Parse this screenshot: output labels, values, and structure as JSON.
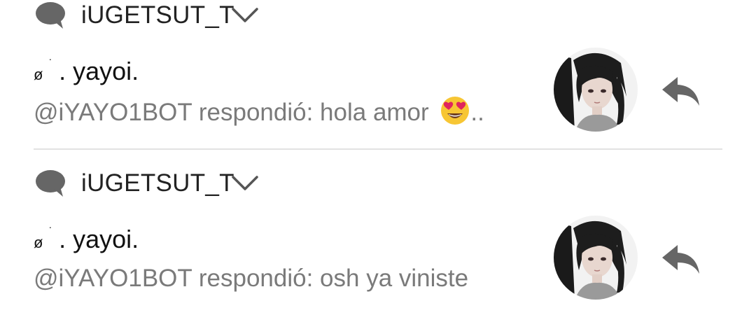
{
  "notifications": [
    {
      "app_name": "iUGETSUT_T",
      "sender_prefix": "ø",
      "sender_dot": "·",
      "sender_name": ". yayoi.",
      "message": "@iYAYO1BOT respondió: hola amor",
      "message_suffix": "..",
      "emoji": "heart-eyes-emoji",
      "avatar": "anime-girl-avatar",
      "action_icon": "reply-icon"
    },
    {
      "app_name": "iUGETSUT_T",
      "sender_prefix": "ø",
      "sender_dot": "·",
      "sender_name": ". yayoi.",
      "message": "@iYAYO1BOT respondió: osh ya viniste",
      "avatar": "anime-girl-avatar",
      "action_icon": "reply-icon"
    }
  ],
  "colors": {
    "icon_gray": "#666666",
    "text_primary": "#111111",
    "text_secondary": "#7a7a7a",
    "divider": "#e2e2e2",
    "emoji_face": "#f7c634",
    "emoji_heart": "#e0245e"
  }
}
